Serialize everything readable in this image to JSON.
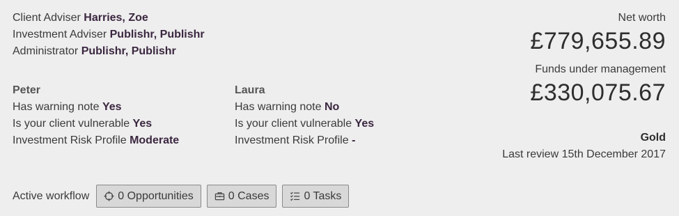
{
  "advisers": {
    "client_adviser_label": "Client Adviser",
    "client_adviser_value": "Harries, Zoe",
    "investment_adviser_label": "Investment Adviser",
    "investment_adviser_value": "Publishr, Publishr",
    "administrator_label": "Administrator",
    "administrator_value": "Publishr, Publishr"
  },
  "clients": [
    {
      "name": "Peter",
      "warning_label": "Has warning note",
      "warning_value": "Yes",
      "vulnerable_label": "Is your client vulnerable",
      "vulnerable_value": "Yes",
      "risk_label": "Investment Risk Profile",
      "risk_value": "Moderate"
    },
    {
      "name": "Laura",
      "warning_label": "Has warning note",
      "warning_value": "No",
      "vulnerable_label": "Is your client vulnerable",
      "vulnerable_value": "Yes",
      "risk_label": "Investment Risk Profile",
      "risk_value": "-"
    }
  ],
  "summary": {
    "net_worth_label": "Net worth",
    "net_worth_value": "£779,655.89",
    "fum_label": "Funds under management",
    "fum_value": "£330,075.67",
    "tier": "Gold",
    "last_review": "Last review 15th December 2017"
  },
  "workflow": {
    "label": "Active workflow",
    "buttons": [
      {
        "label": "0 Opportunities",
        "icon": "crosshair-icon"
      },
      {
        "label": "0 Cases",
        "icon": "briefcase-icon"
      },
      {
        "label": "0 Tasks",
        "icon": "checklist-icon"
      }
    ]
  }
}
